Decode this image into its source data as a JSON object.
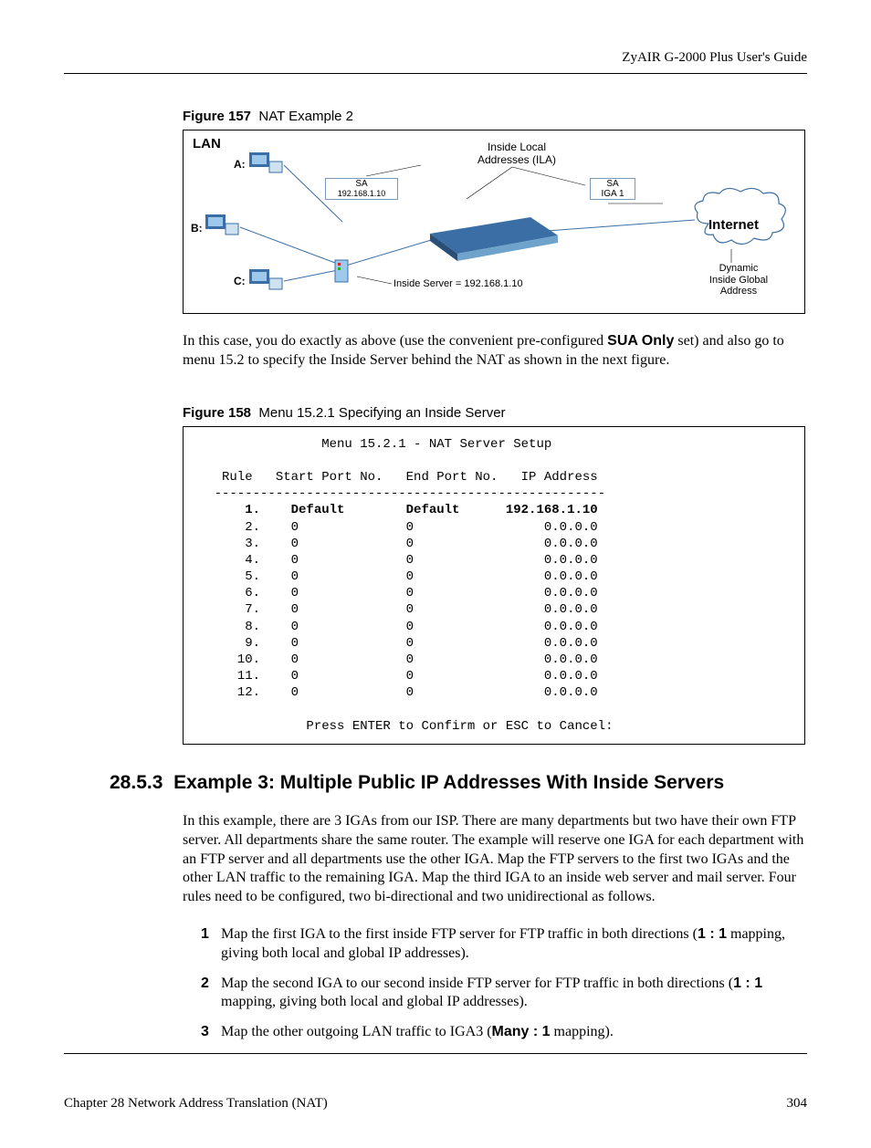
{
  "header": {
    "guide_title": "ZyAIR G-2000 Plus User's Guide"
  },
  "fig157": {
    "caption_num": "Figure 157",
    "caption_text": "NAT Example 2",
    "lan": "LAN",
    "ila": "Inside Local\nAddresses (ILA)",
    "sa": "SA",
    "sa1_ip": "192.168.1.10",
    "iga": "IGA 1",
    "host_a": "A:",
    "host_b": "B:",
    "host_c": "C:",
    "inside_server": "Inside Server = 192.168.1.10",
    "internet": "Internet",
    "dyn": "Dynamic\nInside Global\nAddress"
  },
  "para1_a": "In this case, you do exactly as above (use the convenient pre-configured ",
  "para1_bold": "SUA Only",
  "para1_b": " set) and also go to menu 15.2 to specify the Inside Server behind the NAT as shown in the next figure.",
  "fig158": {
    "caption_num": "Figure 158",
    "caption_text": "Menu 15.2.1 Specifying an Inside Server",
    "menu_title": "Menu 15.2.1 - NAT Server Setup",
    "header_row": "     Rule   Start Port No.   End Port No.   IP Address",
    "divider": "    ---------------------------------------------------",
    "rows": [
      {
        "n": "1.",
        "s": "Default",
        "e": "Default",
        "ip": "192.168.1.10",
        "bold": true
      },
      {
        "n": "2.",
        "s": "0",
        "e": "0",
        "ip": "0.0.0.0",
        "bold": false
      },
      {
        "n": "3.",
        "s": "0",
        "e": "0",
        "ip": "0.0.0.0",
        "bold": false
      },
      {
        "n": "4.",
        "s": "0",
        "e": "0",
        "ip": "0.0.0.0",
        "bold": false
      },
      {
        "n": "5.",
        "s": "0",
        "e": "0",
        "ip": "0.0.0.0",
        "bold": false
      },
      {
        "n": "6.",
        "s": "0",
        "e": "0",
        "ip": "0.0.0.0",
        "bold": false
      },
      {
        "n": "7.",
        "s": "0",
        "e": "0",
        "ip": "0.0.0.0",
        "bold": false
      },
      {
        "n": "8.",
        "s": "0",
        "e": "0",
        "ip": "0.0.0.0",
        "bold": false
      },
      {
        "n": "9.",
        "s": "0",
        "e": "0",
        "ip": "0.0.0.0",
        "bold": false
      },
      {
        "n": "10.",
        "s": "0",
        "e": "0",
        "ip": "0.0.0.0",
        "bold": false
      },
      {
        "n": "11.",
        "s": "0",
        "e": "0",
        "ip": "0.0.0.0",
        "bold": false
      },
      {
        "n": "12.",
        "s": "0",
        "e": "0",
        "ip": "0.0.0.0",
        "bold": false
      }
    ],
    "footer": "Press ENTER to Confirm or ESC to Cancel:"
  },
  "section": {
    "num": "28.5.3",
    "title": "Example 3: Multiple Public IP Addresses With Inside Servers"
  },
  "para2": "In this example, there are 3 IGAs from our ISP. There are many departments but two have their own FTP server. All departments share the same router. The example will reserve one IGA for each department with an FTP server and all departments use the other IGA. Map the FTP servers to the first two IGAs and the other LAN traffic to the remaining IGA. Map the third IGA to an inside web server and mail server. Four rules need to be configured, two bi-directional and two unidirectional as follows.",
  "list": [
    {
      "n": "1",
      "a": "Map the first IGA to the first inside FTP server for FTP traffic in both directions (",
      "b": "1 : 1",
      "c": " mapping, giving both local and global IP addresses)."
    },
    {
      "n": "2",
      "a": "Map the second IGA to our second inside FTP server for FTP traffic in both directions (",
      "b": "1 : 1",
      "c": " mapping, giving both local and global IP addresses)."
    },
    {
      "n": "3",
      "a": "Map the other outgoing LAN traffic to IGA3 (",
      "b": "Many : 1",
      "c": " mapping)."
    }
  ],
  "footer": {
    "chapter": "Chapter 28 Network Address Translation (NAT)",
    "page": "304"
  }
}
